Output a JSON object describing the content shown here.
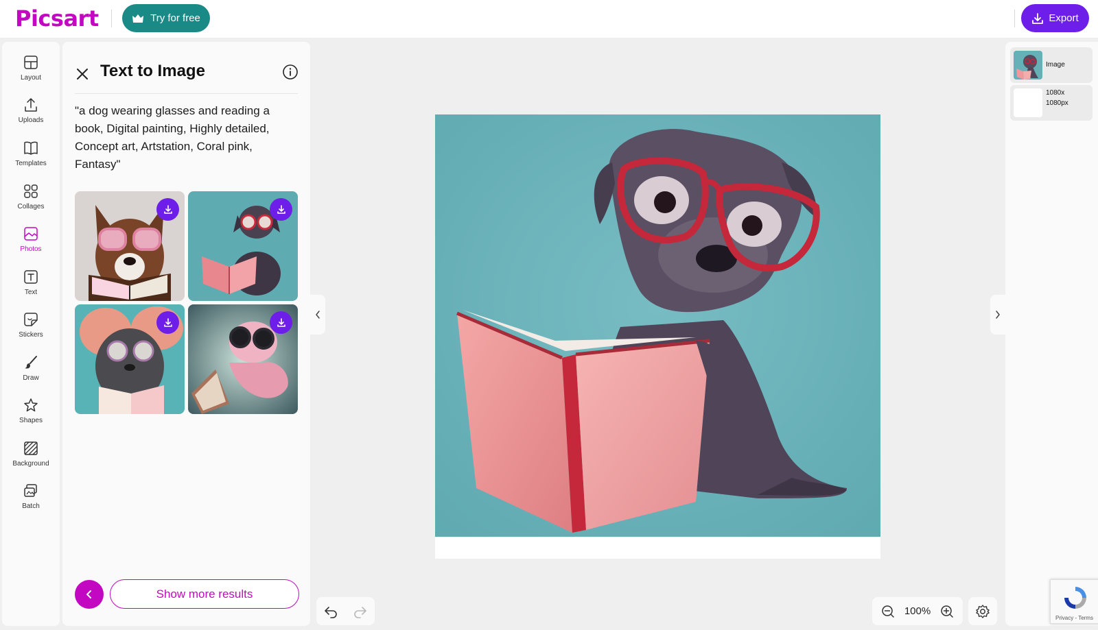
{
  "app": {
    "logo": "Picsart",
    "try_button": "Try for free",
    "export_button": "Export"
  },
  "sidebar": {
    "items": [
      {
        "label": "Layout",
        "icon": "layout-icon"
      },
      {
        "label": "Uploads",
        "icon": "upload-icon"
      },
      {
        "label": "Templates",
        "icon": "templates-icon"
      },
      {
        "label": "Collages",
        "icon": "collages-icon"
      },
      {
        "label": "Photos",
        "icon": "photos-icon",
        "active": true
      },
      {
        "label": "Text",
        "icon": "text-icon"
      },
      {
        "label": "Stickers",
        "icon": "stickers-icon"
      },
      {
        "label": "Draw",
        "icon": "brush-icon"
      },
      {
        "label": "Shapes",
        "icon": "star-icon"
      },
      {
        "label": "Background",
        "icon": "background-icon"
      },
      {
        "label": "Batch",
        "icon": "batch-icon"
      }
    ]
  },
  "panel": {
    "title": "Text to Image",
    "prompt": "\"a dog wearing glasses and reading a book, Digital painting, Highly detailed, Concept art, Artstation, Coral pink, Fantasy\"",
    "results": [
      {
        "name": "result-1",
        "icon": "download-icon"
      },
      {
        "name": "result-2",
        "icon": "download-icon"
      },
      {
        "name": "result-3",
        "icon": "download-icon"
      },
      {
        "name": "result-4",
        "icon": "download-icon"
      }
    ],
    "show_more": "Show more results"
  },
  "canvas": {
    "zoom": "100%"
  },
  "layers": {
    "items": [
      {
        "label": "Image"
      },
      {
        "label_line1": "1080x",
        "label_line2": "1080px"
      }
    ]
  },
  "recaptcha": {
    "text": "Privacy - Terms"
  },
  "colors": {
    "brand": "#c209c1",
    "accent": "#6d1ee8",
    "try_button": "#1a8a87",
    "canvas_bg": "#6ab5bd"
  }
}
